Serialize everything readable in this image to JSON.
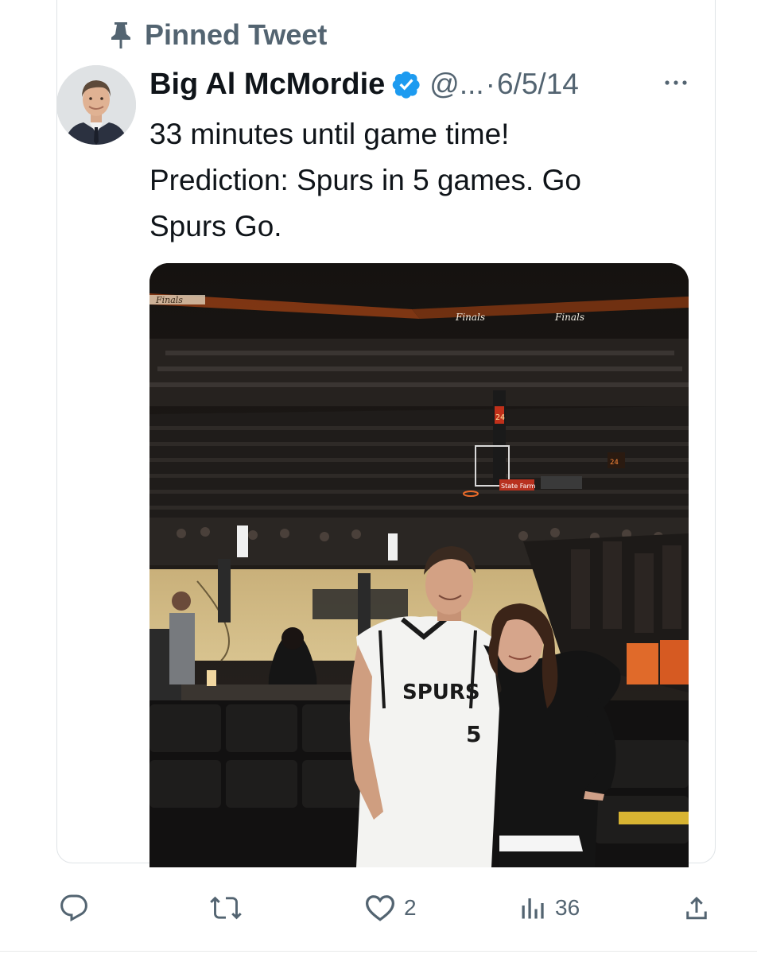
{
  "pinned": {
    "label": "Pinned Tweet",
    "icon": "pin-icon"
  },
  "tweet": {
    "author": {
      "name": "Big Al McMordie",
      "handle": "@...",
      "verified": true
    },
    "separator": "·",
    "date": "6/5/14",
    "text_lines": [
      "33 minutes until game time!",
      "Prediction:  Spurs in 5 games. Go",
      "Spurs Go."
    ],
    "photo": {
      "banner_text": "Finals",
      "jersey_text": "SPURS",
      "jersey_number": "5",
      "shot_clock": "24",
      "sponsor_text": "State Farm"
    }
  },
  "actions": {
    "reply": {
      "icon": "reply-icon",
      "count": ""
    },
    "retweet": {
      "icon": "retweet-icon",
      "count": ""
    },
    "like": {
      "icon": "heart-icon",
      "count": "2"
    },
    "views": {
      "icon": "views-icon",
      "count": "36"
    },
    "share": {
      "icon": "share-icon",
      "count": ""
    }
  },
  "colors": {
    "verified": "#1d9bf0",
    "secondary_text": "#536471",
    "primary_text": "#0f1419"
  }
}
